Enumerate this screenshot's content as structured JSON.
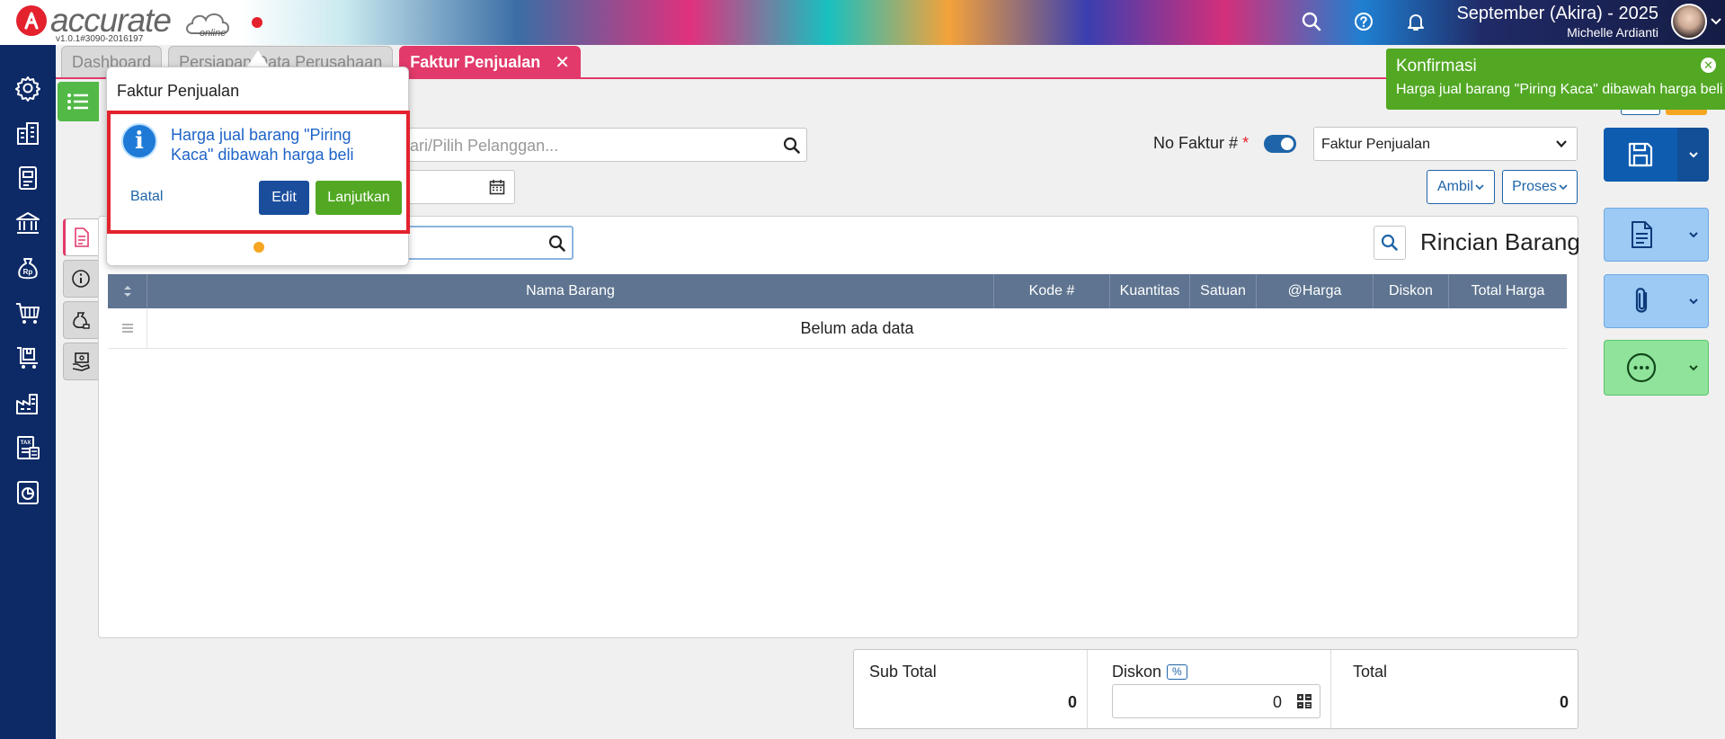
{
  "header": {
    "logo_text": "accurate",
    "logo_sub": "online",
    "version": "v1.0.1#3090-2016197",
    "period": "September (Akira) - 2025",
    "user": "Michelle Ardianti",
    "icons": [
      "search-icon",
      "help-icon",
      "bell-icon"
    ]
  },
  "tabs": [
    {
      "label": "Dashboard"
    },
    {
      "label": "Persiapan Data Perusahaan"
    },
    {
      "label": "Faktur Penjualan",
      "close": "✕"
    }
  ],
  "form": {
    "customer_placeholder": "Cari/Pilih Pelanggan...",
    "nofaktur_label": "No Faktur #",
    "required_mark": "*",
    "faktur_type": "Faktur Penjualan",
    "ambil_label": "Ambil",
    "proses_label": "Proses"
  },
  "rincian": {
    "title": "Rincian Barang",
    "columns": [
      "Nama Barang",
      "Kode #",
      "Kuantitas",
      "Satuan",
      "@Harga",
      "Diskon",
      "Total Harga"
    ],
    "empty_text": "Belum ada data"
  },
  "totals": {
    "subtotal_label": "Sub Total",
    "subtotal_value": "0",
    "diskon_label": "Diskon",
    "diskon_badge": "%",
    "diskon_value": "0",
    "total_label": "Total",
    "total_value": "0"
  },
  "popup": {
    "title": "Faktur Penjualan",
    "message": "Harga jual barang \"Piring Kaca\" dibawah harga beli",
    "batal": "Batal",
    "edit": "Edit",
    "lanjutkan": "Lanjutkan"
  },
  "toast": {
    "title": "Konfirmasi",
    "message": "Harga jual barang \"Piring Kaca\" dibawah harga beli",
    "close": "✕"
  },
  "colors": {
    "sidebar": "#0e2a66",
    "accent_pink": "#e23a6a",
    "primary_blue": "#1e64a8",
    "success_green": "#52a823",
    "alert_red": "#e3222d"
  }
}
